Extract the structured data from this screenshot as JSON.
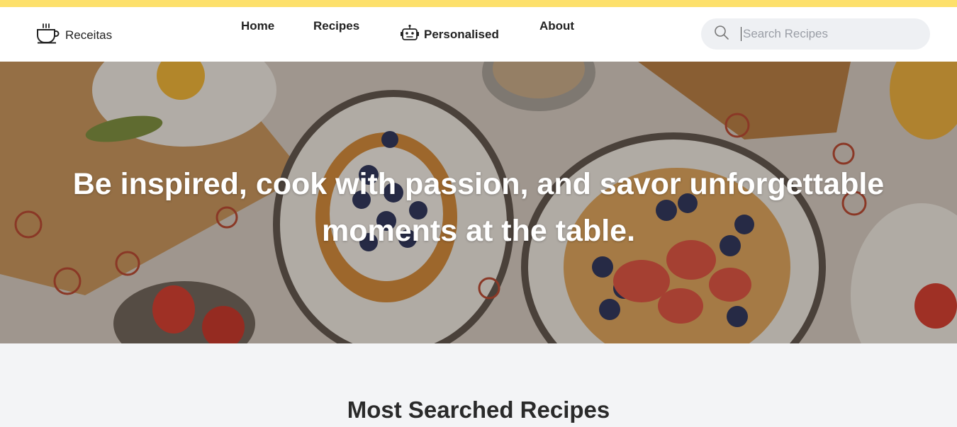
{
  "colors": {
    "accent_bar": "#fde06b",
    "header_bg": "#ffffff",
    "search_bg": "#eef0f3",
    "page_bg": "#f3f4f6"
  },
  "brand": {
    "name": "Receitas",
    "icon": "coffee-cup-icon"
  },
  "nav": {
    "items": [
      {
        "label": "Home"
      },
      {
        "label": "Recipes"
      },
      {
        "label": "Personalised",
        "icon": "robot-icon"
      },
      {
        "label": "About"
      }
    ]
  },
  "search": {
    "placeholder": "Search Recipes",
    "value": "",
    "icon": "search-icon"
  },
  "hero": {
    "title": "Be inspired, cook with passion, and savor unforgettable moments at the table."
  },
  "section": {
    "title": "Most Searched Recipes"
  }
}
